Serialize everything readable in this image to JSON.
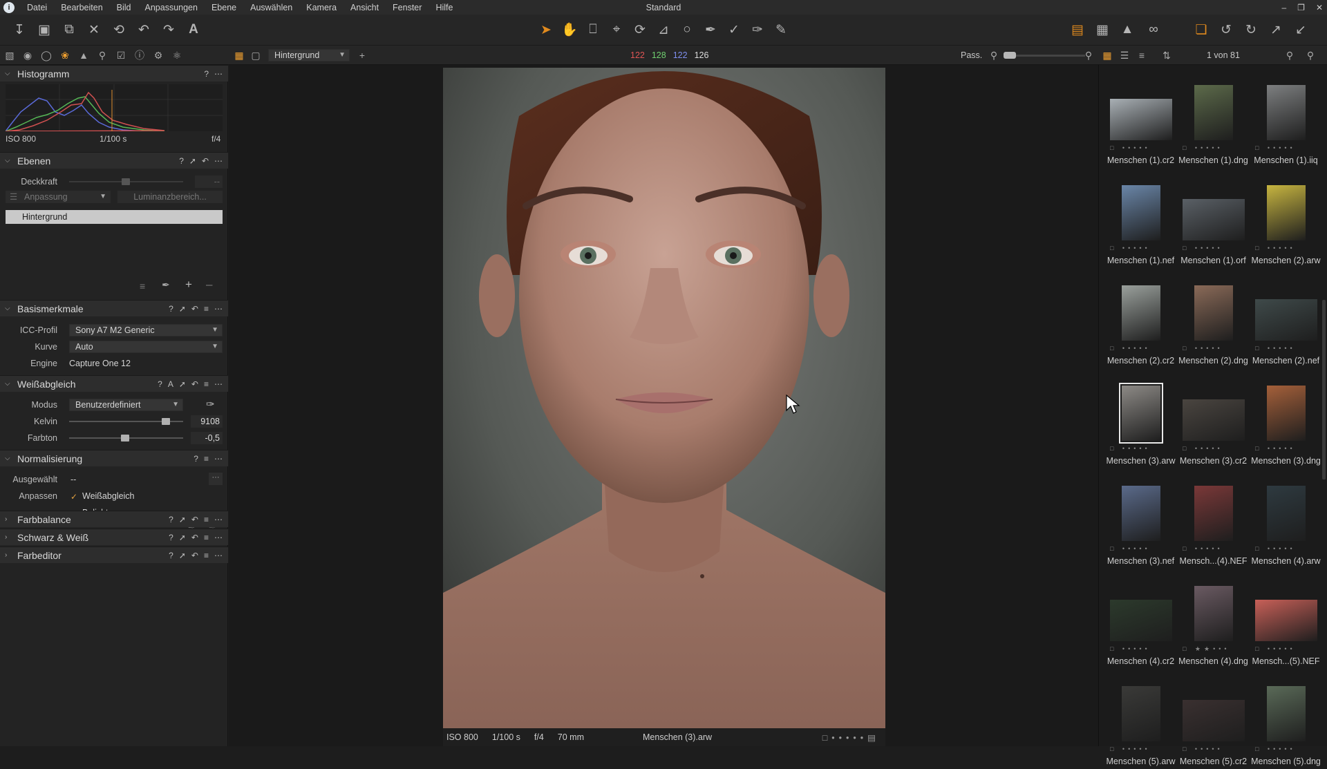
{
  "window": {
    "title": "Standard"
  },
  "menu": [
    "Datei",
    "Bearbeiten",
    "Bild",
    "Anpassungen",
    "Ebene",
    "Auswählen",
    "Kamera",
    "Ansicht",
    "Fenster",
    "Hilfe"
  ],
  "bar2": {
    "layer_select": "Hintergrund",
    "rgb": {
      "r": "122",
      "g": "128",
      "b": "122",
      "l": "126"
    },
    "pass_label": "Pass.",
    "counter": "1 von 81"
  },
  "colors": {
    "accent": "#f0a030",
    "red": "#e05555",
    "green": "#70d070",
    "blue": "#7f8ff0"
  },
  "histogram": {
    "title": "Histogramm",
    "iso": "ISO 800",
    "shutter": "1/100 s",
    "aperture": "f/4"
  },
  "ebenen": {
    "title": "Ebenen",
    "deckkraft_label": "Deckkraft",
    "deckkraft_value": "--",
    "anpassung": "Anpassung",
    "luminanz": "Luminanzbereich...",
    "layer_name": "Hintergrund"
  },
  "basis": {
    "title": "Basismerkmale",
    "icc_label": "ICC-Profil",
    "icc_value": "Sony A7 M2 Generic",
    "kurve_label": "Kurve",
    "kurve_value": "Auto",
    "engine_label": "Engine",
    "engine_value": "Capture One 12"
  },
  "wb": {
    "title": "Weißabgleich",
    "modus_label": "Modus",
    "modus_value": "Benutzerdefiniert",
    "kelvin_label": "Kelvin",
    "kelvin_value": "9108",
    "kelvin_level": 0.85,
    "farbton_label": "Farbton",
    "farbton_value": "-0,5",
    "farbton_level": 0.49
  },
  "norm": {
    "title": "Normalisierung",
    "ausgewaehlt_label": "Ausgewählt",
    "ausgewaehlt_value": "--",
    "anpassen_label": "Anpassen",
    "opt1": "Weißabgleich",
    "opt2": "Belichtung"
  },
  "collapsed": [
    "Farbbalance",
    "Schwarz & Weiß",
    "Farbeditor"
  ],
  "viewer": {
    "iso": "ISO 800",
    "shutter": "1/100 s",
    "aperture": "f/4",
    "focal": "70 mm",
    "filename": "Menschen (3).arw"
  },
  "thumbs": [
    {
      "name": "Menschen (1).cr2",
      "tone": "#a9b0b5",
      "ratio": "land"
    },
    {
      "name": "Menschen (1).dng",
      "tone": "#5c6a4a",
      "ratio": "port"
    },
    {
      "name": "Menschen (1).iiq",
      "tone": "#7d7f80",
      "ratio": "port"
    },
    {
      "name": "Menschen (1).nef",
      "tone": "#6a86a8",
      "ratio": "port"
    },
    {
      "name": "Menschen (1).orf",
      "tone": "#5a6066",
      "ratio": "land"
    },
    {
      "name": "Menschen (2).arw",
      "tone": "#c7b540",
      "ratio": "port"
    },
    {
      "name": "Menschen (2).cr2",
      "tone": "#9aa09c",
      "ratio": "port"
    },
    {
      "name": "Menschen (2).dng",
      "tone": "#8a6a58",
      "ratio": "port"
    },
    {
      "name": "Menschen (2).nef",
      "tone": "#3f4a4a",
      "ratio": "land"
    },
    {
      "name": "Menschen (3).arw",
      "tone": "#8d8a86",
      "ratio": "port",
      "selected": true
    },
    {
      "name": "Menschen (3).cr2",
      "tone": "#4a4540",
      "ratio": "land"
    },
    {
      "name": "Menschen (3).dng",
      "tone": "#a5603a",
      "ratio": "port"
    },
    {
      "name": "Menschen (3).nef",
      "tone": "#5a6a8a",
      "ratio": "port"
    },
    {
      "name": "Mensch...(4).NEF",
      "tone": "#7a3838",
      "ratio": "port"
    },
    {
      "name": "Menschen (4).arw",
      "tone": "#2e3a40",
      "ratio": "port"
    },
    {
      "name": "Menschen (4).cr2",
      "tone": "#2c3a2c",
      "ratio": "land"
    },
    {
      "name": "Menschen (4).dng",
      "tone": "#6a5a62",
      "ratio": "port",
      "stars": "★★"
    },
    {
      "name": "Mensch...(5).NEF",
      "tone": "#c86058",
      "ratio": "land"
    },
    {
      "name": "Menschen (5).arw",
      "tone": "#3a3a38",
      "ratio": "port"
    },
    {
      "name": "Menschen (5).cr2",
      "tone": "#3a3030",
      "ratio": "land"
    },
    {
      "name": "Menschen (5).dng",
      "tone": "#5a6a58",
      "ratio": "port"
    }
  ]
}
